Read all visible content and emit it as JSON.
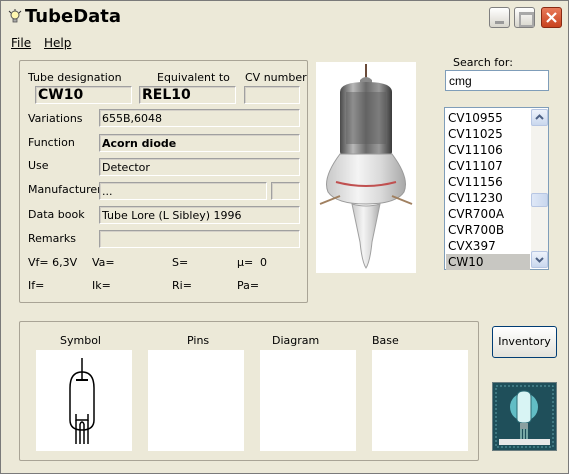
{
  "window": {
    "title": "TubeData"
  },
  "menu": {
    "file": "File",
    "help": "Help"
  },
  "labels": {
    "tube_designation": "Tube designation",
    "equivalent_to": "Equivalent to",
    "cv_number": "CV number",
    "variations": "Variations",
    "function": "Function",
    "use": "Use",
    "manufacturer": "Manufacturer",
    "data_book": "Data book",
    "remarks": "Remarks",
    "vf": "Vf= 6,3V",
    "va": "Va=",
    "s": "S=",
    "mu": "µ=",
    "mu_value": "0",
    "if": "If=",
    "ik": "Ik=",
    "ri": "Ri=",
    "pa": "Pa="
  },
  "fields": {
    "tube_designation": "CW10",
    "equivalent_to": "REL10",
    "cv_number": "",
    "variations": "655B,6048",
    "function": "Acorn diode",
    "use": "Detector",
    "manufacturer": "...",
    "manufacturer_code": "",
    "data_book": "Tube Lore (L Sibley) 1996",
    "remarks": ""
  },
  "search": {
    "label": "Search for:",
    "value": "cmg"
  },
  "tube_list": {
    "items": [
      "CV10955",
      "CV11025",
      "CV11106",
      "CV11107",
      "CV11156",
      "CV11230",
      "CVR700A",
      "CVR700B",
      "CVX397",
      "CW10"
    ],
    "selected": "CW10"
  },
  "bottom_panels": {
    "symbol": "Symbol",
    "pins": "Pins",
    "diagram": "Diagram",
    "base": "Base"
  },
  "buttons": {
    "inventory": "Inventory"
  },
  "colors": {
    "window_bg": "#ece9d8",
    "selection": "#c8c7c2",
    "close_button": "#c8421e",
    "logo_bg": "#1f4f5a"
  },
  "icons": {
    "app": "lightbulb-icon",
    "minimize": "minimize-icon",
    "maximize": "maximize-icon",
    "close": "close-icon"
  }
}
